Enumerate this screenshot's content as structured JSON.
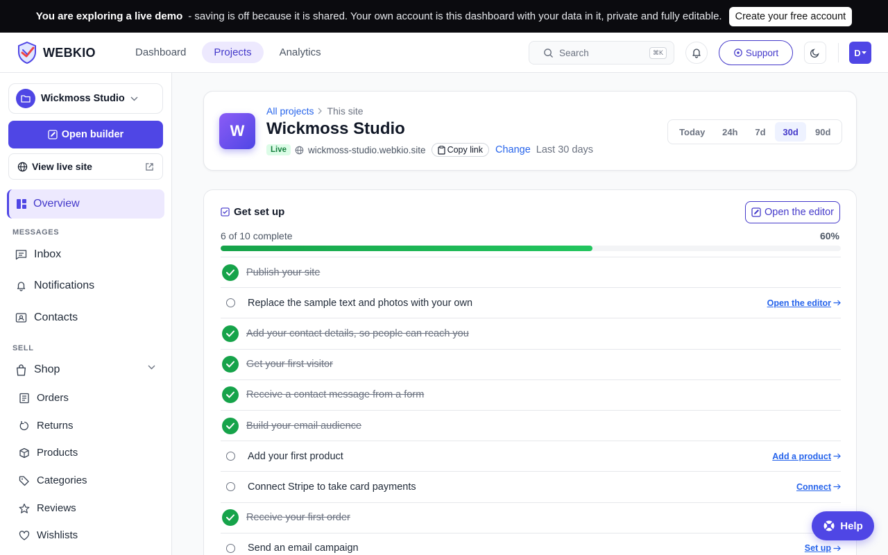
{
  "banner": {
    "strong": "You are exploring a live demo",
    "rest": "- saving is off because it is shared. Your own account is this dashboard with your data in it, private and fully editable.",
    "cta": "Create your free account"
  },
  "header": {
    "logo": "WEBKIO",
    "tabs": [
      "Dashboard",
      "Projects",
      "Analytics"
    ],
    "active_tab": "Projects",
    "search_placeholder": "Search",
    "search_shortcut": "⌘K",
    "support_label": "Support",
    "avatar_initial": "D"
  },
  "sidebar": {
    "project_name": "Wickmoss Studio",
    "open_builder": "Open builder",
    "view_live": "View live site",
    "overview": "Overview",
    "messages_title": "MESSAGES",
    "messages": [
      "Inbox",
      "Notifications",
      "Contacts"
    ],
    "sell_title": "SELL",
    "shop": "Shop",
    "shop_items": [
      "Orders",
      "Returns",
      "Products",
      "Categories",
      "Reviews",
      "Wishlists"
    ]
  },
  "project": {
    "initial": "W",
    "breadcrumb_link": "All projects",
    "breadcrumb_current": "This site",
    "name": "Wickmoss Studio",
    "status": "Live",
    "domain": "wickmoss-studio.webkio.site",
    "copy_label": "Copy link",
    "change_label": "Change",
    "range_label": "Last 30 days",
    "ranges": [
      "Today",
      "24h",
      "7d",
      "30d",
      "90d"
    ],
    "active_range": "30d"
  },
  "setup": {
    "title": "Get set up",
    "open_editor": "Open the editor",
    "progress_text": "6 of 10 complete",
    "progress_pct": "60%",
    "progress_value": 0.6,
    "tasks": [
      {
        "label": "Publish your site",
        "done": true,
        "action": ""
      },
      {
        "label": "Replace the sample text and photos with your own",
        "done": false,
        "action": "Open the editor"
      },
      {
        "label": "Add your contact details, so people can reach you",
        "done": true,
        "action": ""
      },
      {
        "label": "Get your first visitor",
        "done": true,
        "action": ""
      },
      {
        "label": "Receive a contact message from a form",
        "done": true,
        "action": ""
      },
      {
        "label": "Build your email audience",
        "done": true,
        "action": ""
      },
      {
        "label": "Add your first product",
        "done": false,
        "action": "Add a product"
      },
      {
        "label": "Connect Stripe to take card payments",
        "done": false,
        "action": "Connect"
      },
      {
        "label": "Receive your first order",
        "done": true,
        "action": ""
      },
      {
        "label": "Send an email campaign",
        "done": false,
        "action": "Set up"
      }
    ]
  },
  "help_label": "Help",
  "colors": {
    "accent": "#4f46e5",
    "success": "#16a34a",
    "link": "#2563eb"
  }
}
